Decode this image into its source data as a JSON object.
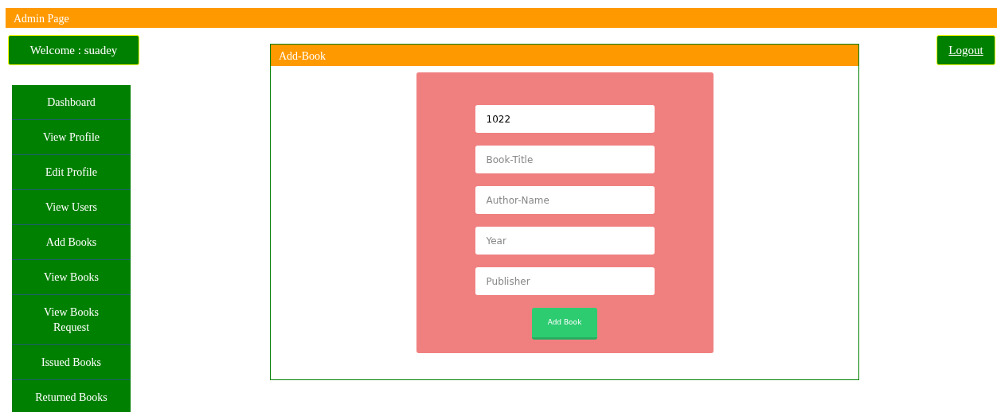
{
  "header": {
    "title": "Admin Page"
  },
  "welcome": {
    "label": "Welcome : suadey"
  },
  "logout": {
    "label": "Logout"
  },
  "sidebar": {
    "items": [
      {
        "label": "Dashboard"
      },
      {
        "label": "View Profile"
      },
      {
        "label": "Edit Profile"
      },
      {
        "label": "View Users"
      },
      {
        "label": "Add Books"
      },
      {
        "label": "View Books"
      },
      {
        "label": "View Books Request"
      },
      {
        "label": "Issued Books"
      },
      {
        "label": "Returned Books"
      }
    ]
  },
  "panel": {
    "title": "Add-Book",
    "fields": [
      {
        "value": "1022"
      },
      {
        "placeholder": "Book-Title"
      },
      {
        "placeholder": "Author-Name"
      },
      {
        "placeholder": "Year"
      },
      {
        "placeholder": "Publisher"
      }
    ],
    "submit": "Add Book"
  }
}
